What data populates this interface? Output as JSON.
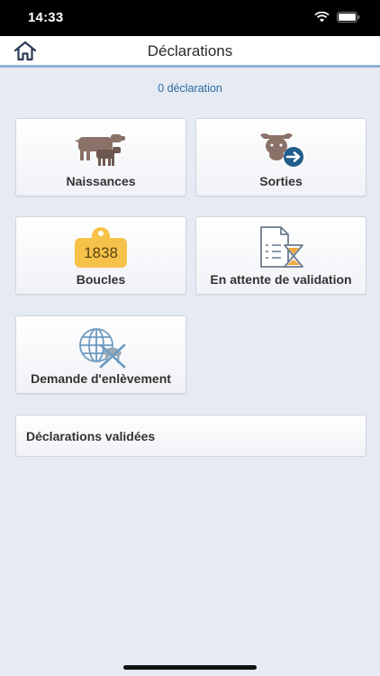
{
  "status": {
    "time": "14:33"
  },
  "nav": {
    "title": "Déclarations"
  },
  "summary": {
    "count_label": "0 déclaration"
  },
  "tiles": [
    {
      "label": "Naissances"
    },
    {
      "label": "Sorties"
    },
    {
      "label": "Boucles",
      "tag_number": "1838"
    },
    {
      "label": "En attente de validation"
    },
    {
      "label": "Demande d'enlèvement"
    }
  ],
  "validated": {
    "label": "Déclarations validées"
  },
  "colors": {
    "accent": "#2d6aa0",
    "nav_underline": "#8fb0d4",
    "tag": "#f7c24a",
    "cattle": "#8a7268"
  }
}
